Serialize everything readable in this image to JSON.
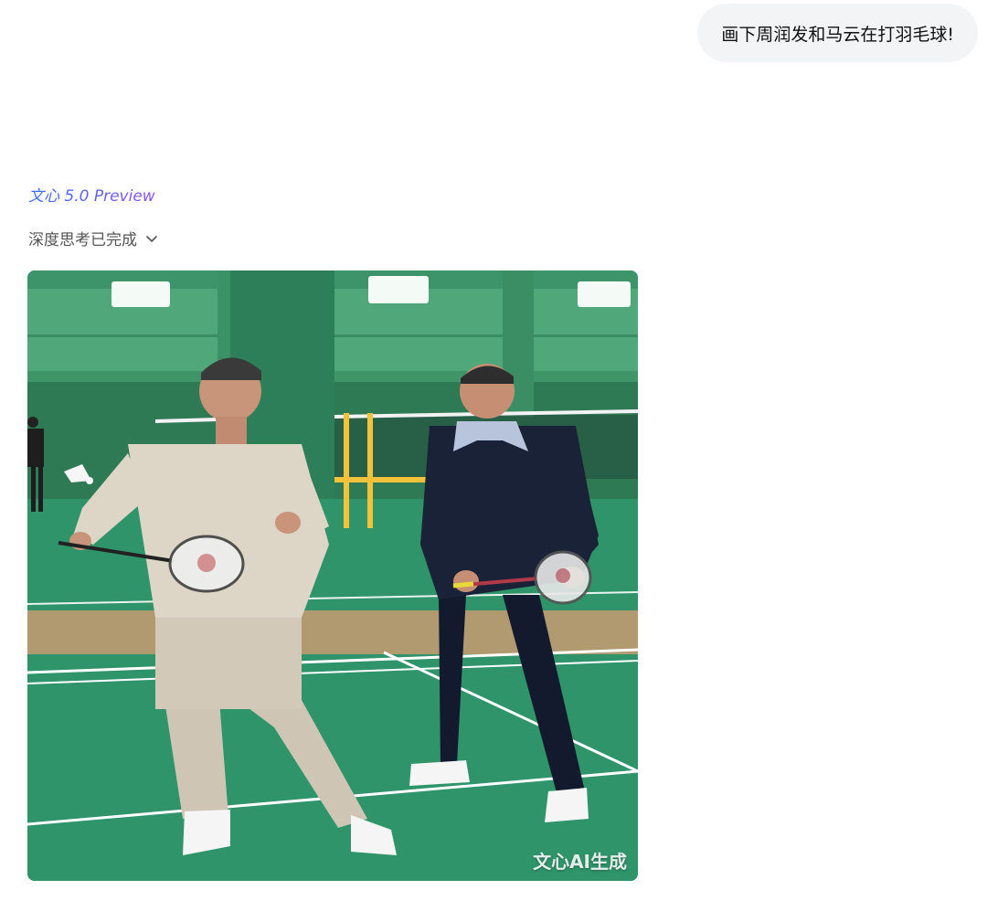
{
  "conversation": {
    "user_message": "画下周润发和马云在打羽毛球!",
    "response": {
      "model_name": "文心 5.0 Preview",
      "thinking_status": "深度思考已完成",
      "thinking_icon": "chevron-down-icon",
      "image": {
        "description_icon": "generated-image",
        "watermark": "文心AI生成"
      }
    }
  },
  "colors": {
    "bubble_bg": "#f3f4f6",
    "court_green": "#2a8a62",
    "wall_green": "#4fa77a",
    "model_gradient_start": "#3a6df0",
    "model_gradient_end": "#8a52f0"
  }
}
